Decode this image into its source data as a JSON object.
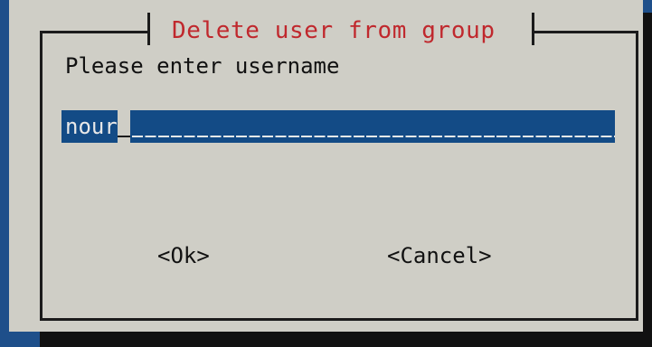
{
  "dialog": {
    "title": "Delete user from group",
    "prompt": "Please enter username",
    "input": {
      "value": "nour"
    },
    "buttons": {
      "ok_label": "<Ok>",
      "cancel_label": "<Cancel>"
    }
  },
  "colors": {
    "background": "#1e4f8a",
    "dialog": "#cfcec6",
    "title": "#c0282d",
    "input_field": "#134b86",
    "text": "#111111"
  }
}
